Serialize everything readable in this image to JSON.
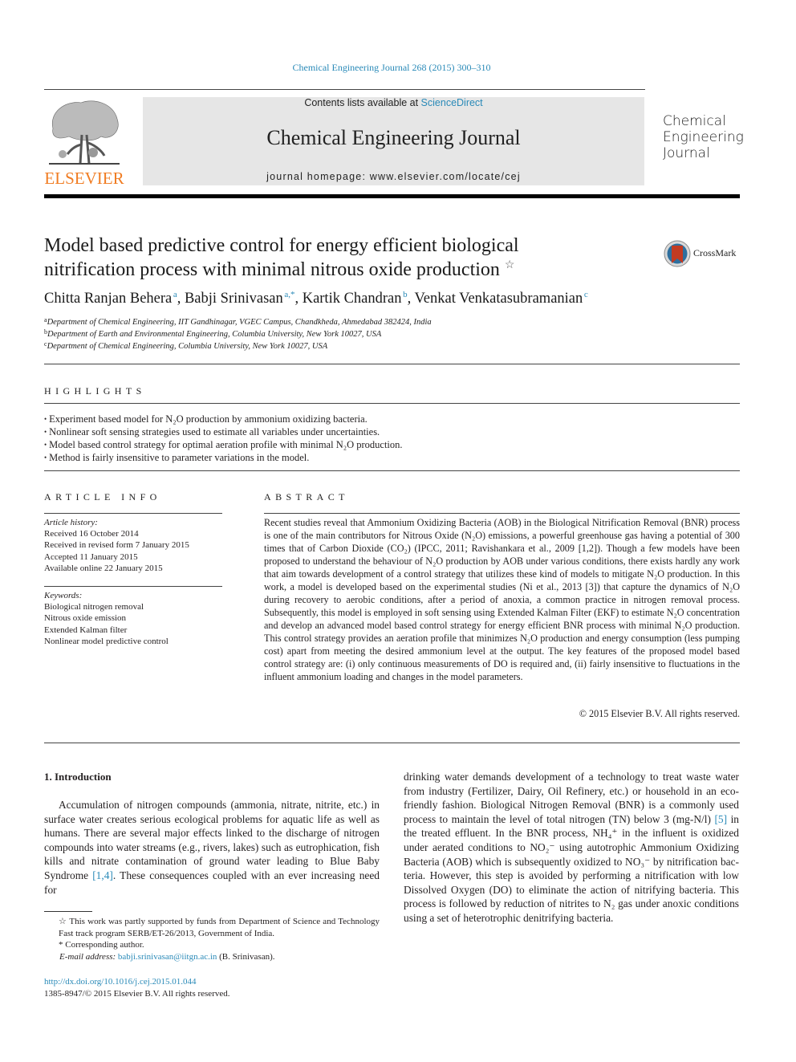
{
  "header": {
    "citation": "Chemical Engineering Journal 268 (2015) 300–310",
    "publisher_logo_text": "ELSEVIER",
    "contents_prefix": "Contents lists available at ",
    "contents_link": "ScienceDirect",
    "journal_name": "Chemical Engineering Journal",
    "homepage": "journal homepage: www.elsevier.com/locate/cej",
    "side_title_lines": [
      "Chemical",
      "Engineering",
      "Journal"
    ]
  },
  "article": {
    "title_line1": "Model based predictive control for energy efficient biological",
    "title_line2": "nitrification process with minimal nitrous oxide production",
    "title_mark": "☆",
    "crossmark_label": "CrossMark",
    "authors": [
      {
        "name": "Chitta Ranjan Behera",
        "sup": "a"
      },
      {
        "name": "Babji Srinivasan",
        "sup": "a,*"
      },
      {
        "name": "Kartik Chandran",
        "sup": "b"
      },
      {
        "name": "Venkat Venkatasubramanian",
        "sup": "c"
      }
    ],
    "affiliations": [
      {
        "sup": "a",
        "text": "Department of Chemical Engineering, IIT Gandhinagar, VGEC Campus, Chandkheda, Ahmedabad 382424, India"
      },
      {
        "sup": "b",
        "text": "Department of Earth and Environmental Engineering, Columbia University, New York 10027, USA"
      },
      {
        "sup": "c",
        "text": "Department of Chemical Engineering, Columbia University, New York 10027, USA"
      }
    ]
  },
  "highlights": {
    "heading": "HIGHLIGHTS",
    "items": [
      "Experiment based model for N₂O production by ammonium oxidizing bacteria.",
      "Nonlinear soft sensing strategies used to estimate all variables under uncertainties.",
      "Model based control strategy for optimal aeration profile with minimal N₂O production.",
      "Method is fairly insensitive to parameter variations in the model."
    ]
  },
  "article_info": {
    "heading": "ARTICLE INFO",
    "history_label": "Article history:",
    "history": [
      "Received 16 October 2014",
      "Received in revised form 7 January 2015",
      "Accepted 11 January 2015",
      "Available online 22 January 2015"
    ],
    "keywords_label": "Keywords:",
    "keywords": [
      "Biological nitrogen removal",
      "Nitrous oxide emission",
      "Extended Kalman filter",
      "Nonlinear model predictive control"
    ]
  },
  "abstract": {
    "heading": "ABSTRACT",
    "text": "Recent studies reveal that Ammonium Oxidizing Bacteria (AOB) in the Biological Nitrification Removal (BNR) process is one of the main contributors for Nitrous Oxide (N₂O) emissions, a powerful greenhouse gas having a potential of 300 times that of Carbon Dioxide (CO₂) (IPCC, 2011; Ravishankara et al., 2009 [1,2]). Though a few models have been proposed to understand the behaviour of N₂O production by AOB under various conditions, there exists hardly any work that aim towards development of a control strategy that utilizes these kind of models to mitigate N₂O production. In this work, a model is developed based on the experimental studies (Ni et al., 2013 [3]) that capture the dynamics of N₂O during recovery to aerobic conditions, after a period of anoxia, a common practice in nitrogen removal process. Subsequently, this model is employed in soft sensing using Extended Kalman Filter (EKF) to estimate N₂O concentration and develop an advanced model based control strategy for energy efficient BNR pro­cess with minimal N₂O production. This control strategy provides an aeration profile that minimizes N₂O production and energy consumption (less pumping cost) apart from meeting the desired ammonium level at the output. The key features of the proposed model based control strategy are: (i) only continuous measurements of DO is required and, (ii) fairly insensitive to fluctuations in the influent ammonium load­ing and changes in the model parameters.",
    "copyright": "© 2015 Elsevier B.V. All rights reserved."
  },
  "body": {
    "section_heading": "1. Introduction",
    "left_before_ref": "Accumulation of nitrogen compounds (ammonia, nitrate, nitrite, etc.) in surface water creates serious ecological problems for aquatic life as well as humans. There are several major effects linked to the discharge of nitrogen compounds into water streams (e.g., rivers, lakes) such as eutrophication, fish kills and nitrate con­tamination of ground water leading to Blue Baby Syndrome ",
    "left_ref": "[1,4]",
    "left_after_ref": ". These consequences coupled with an ever increasing need for",
    "right_p1": "drinking water demands development of a technology to treat waste water from industry (Fertilizer, Dairy, Oil Refinery, etc.) or household in an eco-friendly fashion. Biological Nitrogen Removal (BNR) is a commonly used process to maintain the level of total nitrogen (TN) below 3 (mg-N/l) ",
    "right_ref": "[5]",
    "right_p2": " in the treated effluent. In the BNR process, NH₄⁺ in the influent is oxidized under aerated condi­tions to NO₂⁻ using autotrophic Ammonium Oxidizing Bacteria (AOB) which is subsequently oxidized to NO₃⁻ by nitrification bac­teria. However, this step is avoided by performing a nitrification with low Dissolved Oxygen (DO) to eliminate the action of nitrify­ing bacteria. This process is followed by reduction of nitrites to N₂ gas under anoxic conditions using a set of heterotrophic denitrify­ing bacteria."
  },
  "footnotes": {
    "funding": "☆ This work was partly supported by funds from Department of Science and Technology Fast track program SERB/ET-26/2013, Government of India.",
    "corresponding": "* Corresponding author.",
    "email_label": "E-mail address: ",
    "email": "babji.srinivasan@iitgn.ac.in",
    "email_suffix": " (B. Srinivasan).",
    "doi": "http://dx.doi.org/10.1016/j.cej.2015.01.044",
    "issn": "1385-8947/© 2015 Elsevier B.V. All rights reserved."
  }
}
